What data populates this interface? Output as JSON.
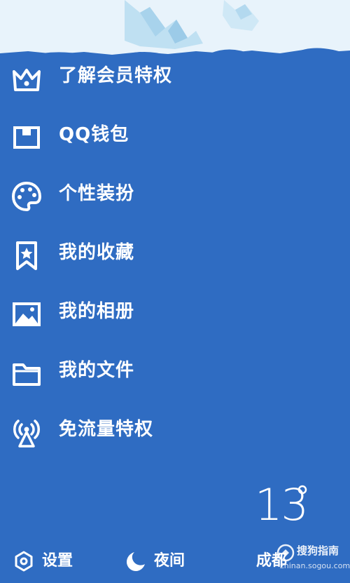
{
  "colors": {
    "panel_background": "#2f6cc2",
    "banner_sky": "#e8f3fb",
    "banner_ice": "#b9dcf0",
    "text": "#ffffff"
  },
  "menu": {
    "items": [
      {
        "icon": "crown-icon",
        "label": "了解会员特权"
      },
      {
        "icon": "wallet-icon",
        "label": "QQ钱包"
      },
      {
        "icon": "palette-icon",
        "label": "个性装扮"
      },
      {
        "icon": "bookmark-star-icon",
        "label": "我的收藏"
      },
      {
        "icon": "image-icon",
        "label": "我的相册"
      },
      {
        "icon": "folder-icon",
        "label": "我的文件"
      },
      {
        "icon": "signal-tower-icon",
        "label": "免流量特权"
      }
    ]
  },
  "weather": {
    "temperature": "13",
    "city": "成都"
  },
  "bottom_bar": {
    "settings_label": "设置",
    "night_label": "夜间"
  },
  "watermark": {
    "logo_icon": "sogou-guide-logo-icon",
    "text": "搜狗指南",
    "url": "zhinan.sogou.com"
  }
}
